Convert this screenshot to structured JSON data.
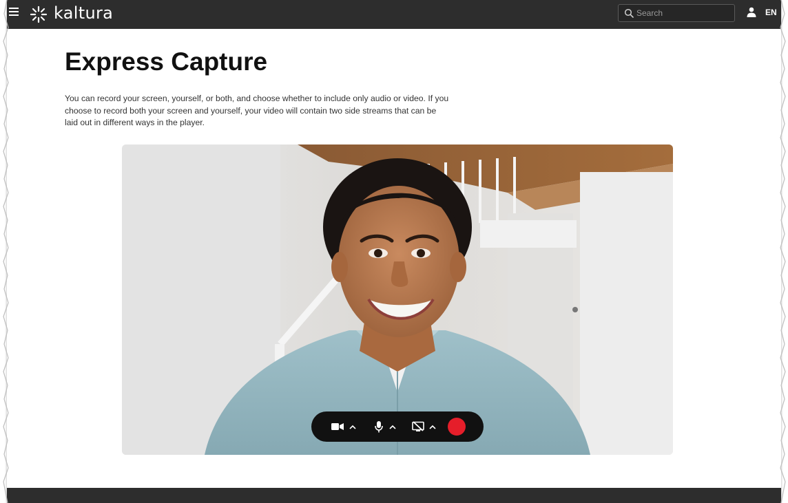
{
  "header": {
    "brand": "kaltura",
    "search_placeholder": "Search",
    "language": "EN",
    "icons": {
      "menu": "hamburger-menu-icon",
      "logo": "kaltura-logo-icon",
      "search": "search-icon",
      "user": "user-icon"
    }
  },
  "main": {
    "title": "Express Capture",
    "description": "You can record your screen, yourself, or both, and choose whether to include only audio or video. If you choose to record both your screen and yourself, your video will contain two side streams that can be laid out in different ways in the player."
  },
  "recorder_toolbar": {
    "icons": [
      "video-camera-icon",
      "chevron-up-icon",
      "microphone-icon",
      "chevron-up-icon",
      "screen-share-off-icon",
      "chevron-up-icon",
      "record-icon"
    ],
    "record_color": "#e51e2a"
  },
  "colors": {
    "header_bg": "#2d2d2d",
    "footer_bg": "#2d2d2d",
    "toolbar_bg": "#111111",
    "title_text": "#111111"
  }
}
